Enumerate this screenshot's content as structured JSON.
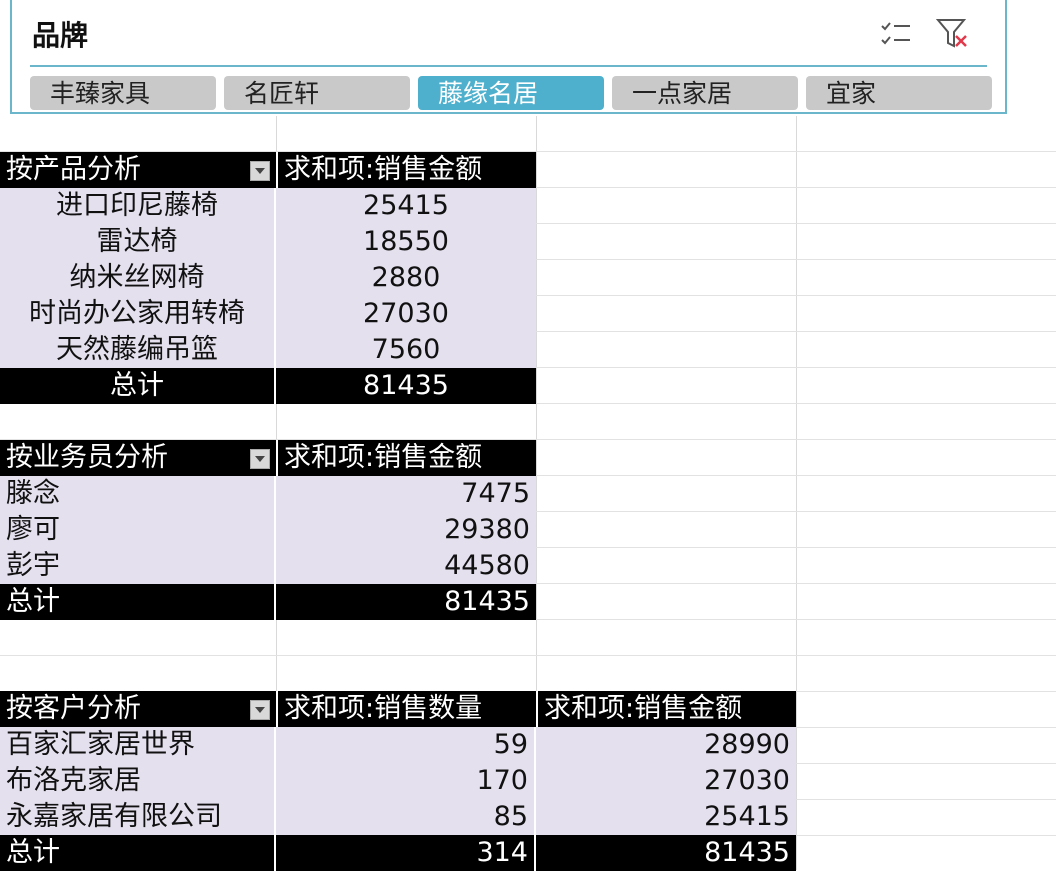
{
  "slicer": {
    "title": "品牌",
    "items": [
      {
        "label": "丰臻家具",
        "selected": false
      },
      {
        "label": "名匠轩",
        "selected": false
      },
      {
        "label": "藤缘名居",
        "selected": true
      },
      {
        "label": "一点家居",
        "selected": false
      },
      {
        "label": "宜家",
        "selected": false
      }
    ],
    "icons": [
      "multi-select-icon",
      "clear-filter-icon"
    ]
  },
  "pivot_product": {
    "header": "按产品分析",
    "value_header": "求和项:销售金额",
    "rows": [
      {
        "label": "进口印尼藤椅",
        "value": "25415"
      },
      {
        "label": "雷达椅",
        "value": "18550"
      },
      {
        "label": "纳米丝网椅",
        "value": "2880"
      },
      {
        "label": "时尚办公家用转椅",
        "value": "27030"
      },
      {
        "label": "天然藤编吊篮",
        "value": "7560"
      }
    ],
    "total_label": "总计",
    "total_value": "81435"
  },
  "pivot_salesperson": {
    "header": "按业务员分析",
    "value_header": "求和项:销售金额",
    "rows": [
      {
        "label": "滕念",
        "value": "7475"
      },
      {
        "label": "廖可",
        "value": "29380"
      },
      {
        "label": "彭宇",
        "value": "44580"
      }
    ],
    "total_label": "总计",
    "total_value": "81435"
  },
  "pivot_customer": {
    "header": "按客户分析",
    "qty_header": "求和项:销售数量",
    "value_header": "求和项:销售金额",
    "rows": [
      {
        "label": "百家汇家居世界",
        "qty": "59",
        "value": "28990"
      },
      {
        "label": "布洛克家居",
        "qty": "170",
        "value": "27030"
      },
      {
        "label": "永嘉家居有限公司",
        "qty": "85",
        "value": "25415"
      }
    ],
    "total_label": "总计",
    "total_qty": "314",
    "total_value": "81435"
  }
}
